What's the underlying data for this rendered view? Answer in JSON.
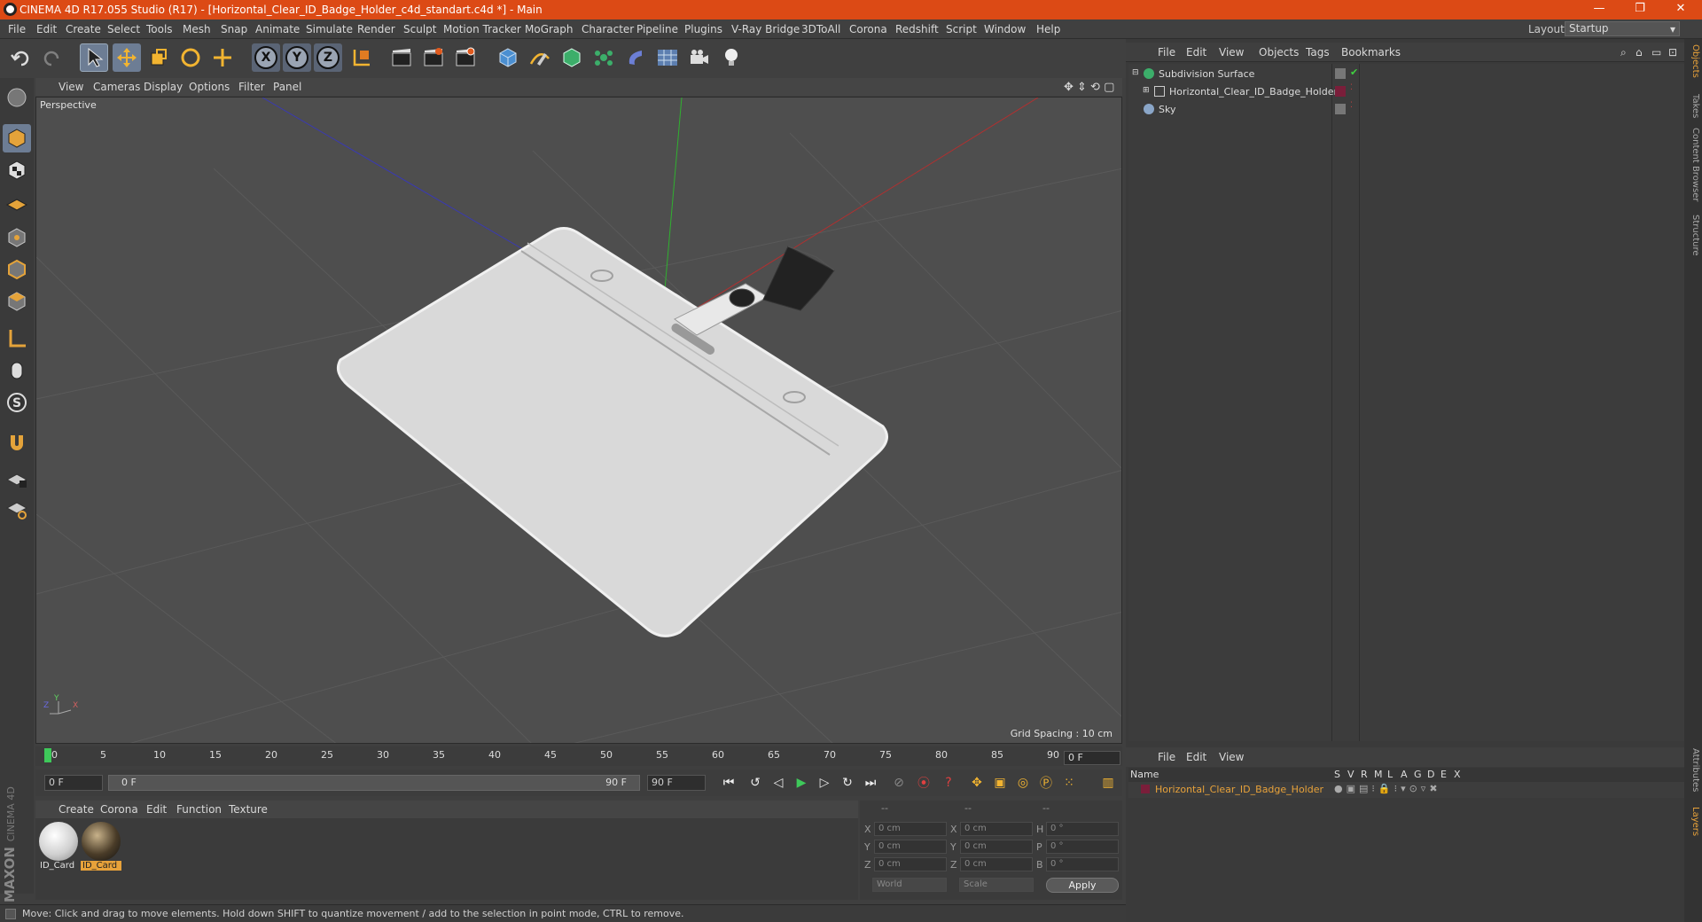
{
  "window": {
    "title": "CINEMA 4D R17.055 Studio (R17) - [Horizontal_Clear_ID_Badge_Holder_c4d_standart.c4d *] - Main",
    "minimize": "—",
    "restore": "❐",
    "close": "✕"
  },
  "menu": [
    "File",
    "Edit",
    "Create",
    "Select",
    "Tools",
    "Mesh",
    "Snap",
    "Animate",
    "Simulate",
    "Render",
    "Sculpt",
    "Motion Tracker",
    "MoGraph",
    "Character",
    "Pipeline",
    "Plugins",
    "V-Ray Bridge",
    "3DToAll",
    "Corona",
    "Redshift",
    "Script",
    "Window",
    "Help"
  ],
  "layout": {
    "label": "Layout:",
    "value": "Startup"
  },
  "toolbar": {
    "axis_x": "X",
    "axis_y": "Y",
    "axis_z": "Z"
  },
  "viewport": {
    "menu": [
      "View",
      "Cameras",
      "Display",
      "Options",
      "Filter",
      "Panel"
    ],
    "label": "Perspective",
    "grid_spacing": "Grid Spacing : 10 cm",
    "axis_labels": {
      "z": "Z",
      "y": "Y",
      "x": "X"
    }
  },
  "timeline": {
    "ticks": [
      "0",
      "5",
      "10",
      "15",
      "20",
      "25",
      "30",
      "35",
      "40",
      "45",
      "50",
      "55",
      "60",
      "65",
      "70",
      "75",
      "80",
      "85",
      "90"
    ],
    "current_frame": "0 F"
  },
  "anim": {
    "start": "0 F",
    "range_start": "0 F",
    "range_end": "90 F",
    "end": "90 F"
  },
  "materials": {
    "menu": [
      "Create",
      "Corona",
      "Edit",
      "Function",
      "Texture"
    ],
    "items": [
      {
        "label": "ID_Card",
        "color": "#e8e8e8",
        "selected": false
      },
      {
        "label": "ID_Card",
        "color": "#5a4a30",
        "selected": true
      }
    ]
  },
  "coords": {
    "headers": [
      "--",
      "--",
      "--"
    ],
    "rows": [
      {
        "a": "X",
        "av": "0 cm",
        "b": "X",
        "bv": "0 cm",
        "c": "H",
        "cv": "0 °"
      },
      {
        "a": "Y",
        "av": "0 cm",
        "b": "Y",
        "bv": "0 cm",
        "c": "P",
        "cv": "0 °"
      },
      {
        "a": "Z",
        "av": "0 cm",
        "b": "Z",
        "bv": "0 cm",
        "c": "B",
        "cv": "0 °"
      }
    ],
    "world": "World",
    "scale": "Scale",
    "apply": "Apply"
  },
  "status": "Move: Click and drag to move elements. Hold down SHIFT to quantize movement / add to the selection in point mode, CTRL to remove.",
  "branding": {
    "maxon": "MAXON",
    "product": "CINEMA 4D"
  },
  "objects": {
    "menu": [
      "File",
      "Edit",
      "View",
      "Objects",
      "Tags",
      "Bookmarks"
    ],
    "rows": [
      {
        "name": "Subdivision Surface",
        "indent": 0
      },
      {
        "name": "Horizontal_Clear_ID_Badge_Holder",
        "indent": 1
      },
      {
        "name": "Sky",
        "indent": 0
      }
    ]
  },
  "layers": {
    "menu": [
      "File",
      "Edit",
      "View"
    ],
    "columns": [
      "Name",
      "S",
      "V",
      "R",
      "M",
      "L",
      "A",
      "G",
      "D",
      "E",
      "X"
    ],
    "row": "Horizontal_Clear_ID_Badge_Holder",
    "accent": "#e8a23a"
  },
  "right_tabs": [
    "Objects",
    "Takes",
    "Content Browser",
    "Structure",
    "Attributes",
    "Layers"
  ]
}
